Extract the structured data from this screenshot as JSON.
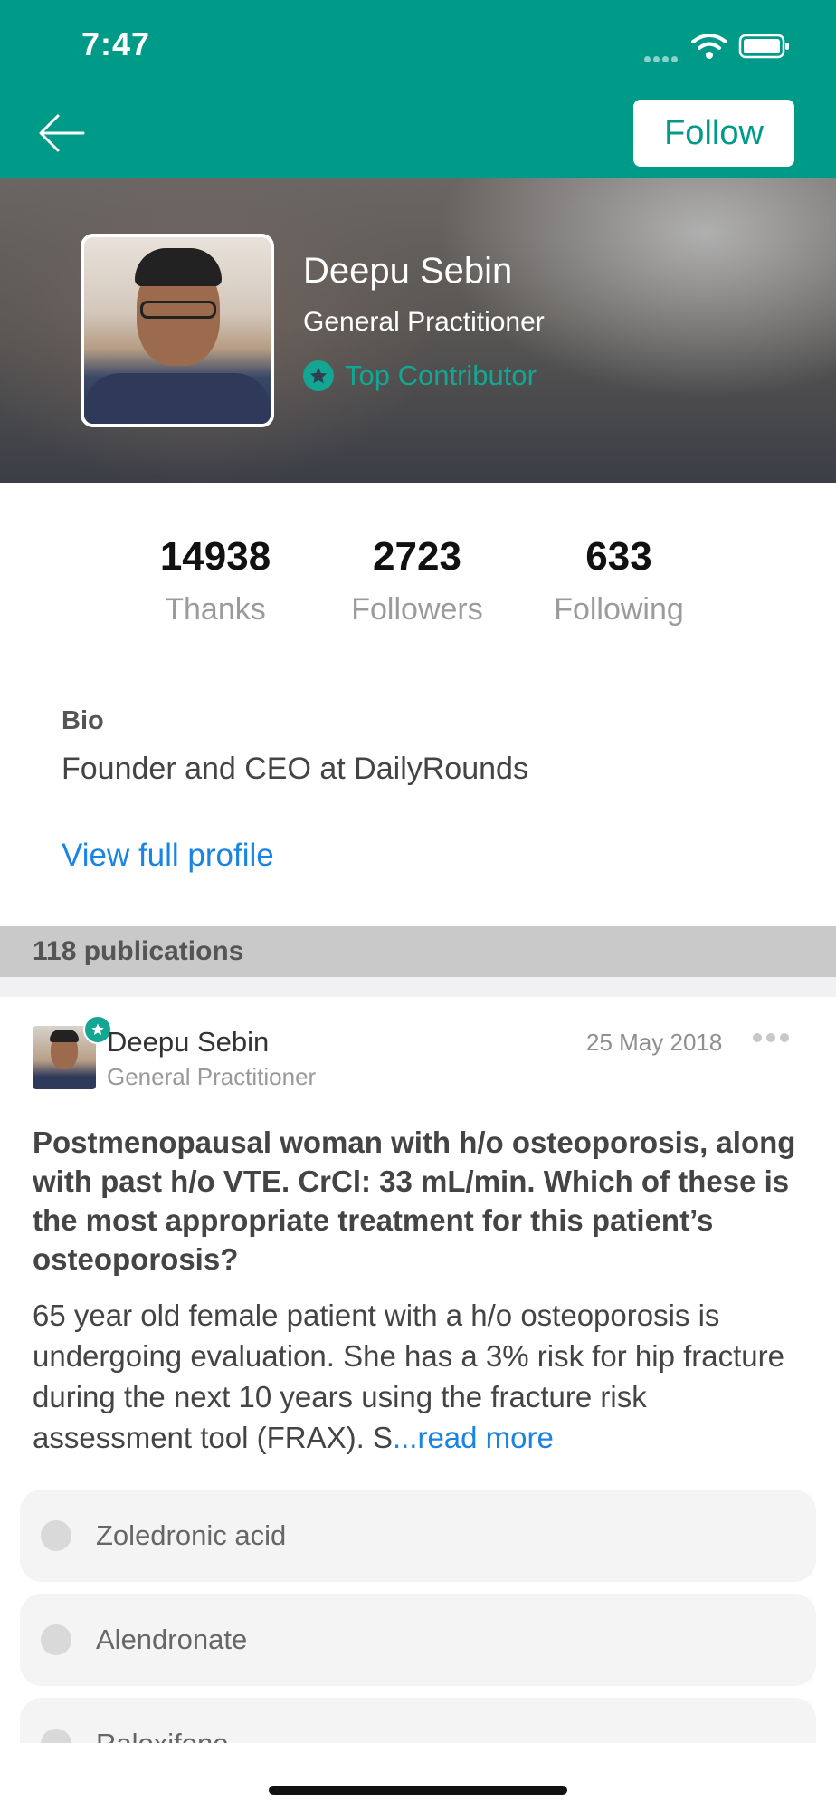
{
  "status_bar": {
    "time": "7:47",
    "icons": [
      "signal-dots-icon",
      "wifi-icon",
      "battery-icon"
    ]
  },
  "nav": {
    "back_icon": "arrow-left-icon",
    "follow_label": "Follow"
  },
  "profile": {
    "name": "Deepu Sebin",
    "role": "General Practitioner",
    "badge": "Top Contributor",
    "badge_icon": "star-icon"
  },
  "stats": [
    {
      "value": "14938",
      "label": "Thanks"
    },
    {
      "value": "2723",
      "label": "Followers"
    },
    {
      "value": "633",
      "label": "Following"
    }
  ],
  "bio": {
    "label": "Bio",
    "text": "Founder and CEO at DailyRounds",
    "link": "View full profile"
  },
  "publications": {
    "count_label": "118 publications"
  },
  "post": {
    "author": "Deepu Sebin",
    "author_role": "General Practitioner",
    "date": "25 May 2018",
    "question": "Postmenopausal woman with h/o osteoporosis, along with past h/o VTE. CrCl: 33 mL/min. Which of these is the most appropriate treatment for this patient’s osteoporosis?",
    "description": "65 year old female patient with a h/o osteoporosis is undergoing evaluation. She has a 3% risk for hip fracture during the next 10 years using the fracture risk assessment tool (FRAX). S",
    "read_more": "...read more",
    "options": [
      "Zoledronic acid",
      "Alendronate",
      "Raloxifene"
    ]
  },
  "colors": {
    "brand": "#009a89",
    "badge": "#12a693",
    "link": "#1a84e4"
  }
}
